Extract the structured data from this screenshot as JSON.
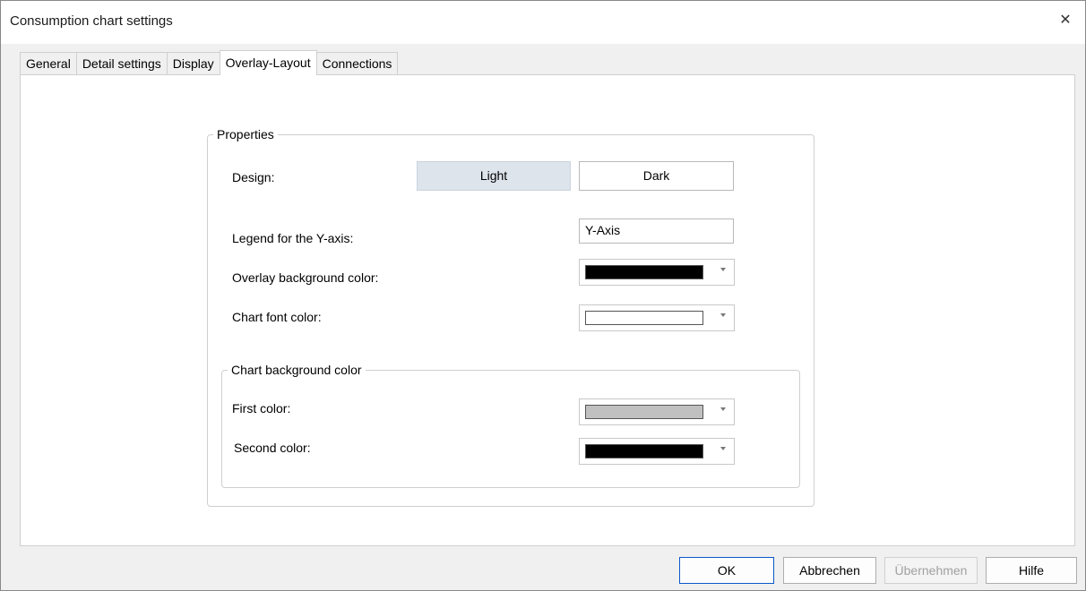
{
  "window": {
    "title": "Consumption chart settings",
    "close_icon": "close-icon"
  },
  "tabs": [
    {
      "label": "General",
      "active": false
    },
    {
      "label": "Detail settings",
      "active": false
    },
    {
      "label": "Display",
      "active": false
    },
    {
      "label": "Overlay-Layout",
      "active": true
    },
    {
      "label": "Connections",
      "active": false
    }
  ],
  "properties": {
    "group_title": "Properties",
    "design_label": "Design:",
    "design_options": [
      "Light",
      "Dark"
    ],
    "design_selected": "Light",
    "y_legend_label": "Legend for the Y-axis:",
    "y_legend_value": "Y-Axis",
    "overlay_bg_label": "Overlay background color:",
    "overlay_bg_color": "#000000",
    "chart_font_label": "Chart font color:",
    "chart_font_color": "#ffffff"
  },
  "chart_background": {
    "group_title": "Chart background color",
    "first_label": "First color:",
    "first_color": "#c0c0c0",
    "second_label": "Second color:",
    "second_color": "#000000"
  },
  "buttons": {
    "ok": "OK",
    "cancel": "Abbrechen",
    "apply": "Übernehmen",
    "help": "Hilfe"
  },
  "colors": {
    "selected_design_bg": "#dde4ec",
    "default_button_border": "#0a58c9"
  }
}
